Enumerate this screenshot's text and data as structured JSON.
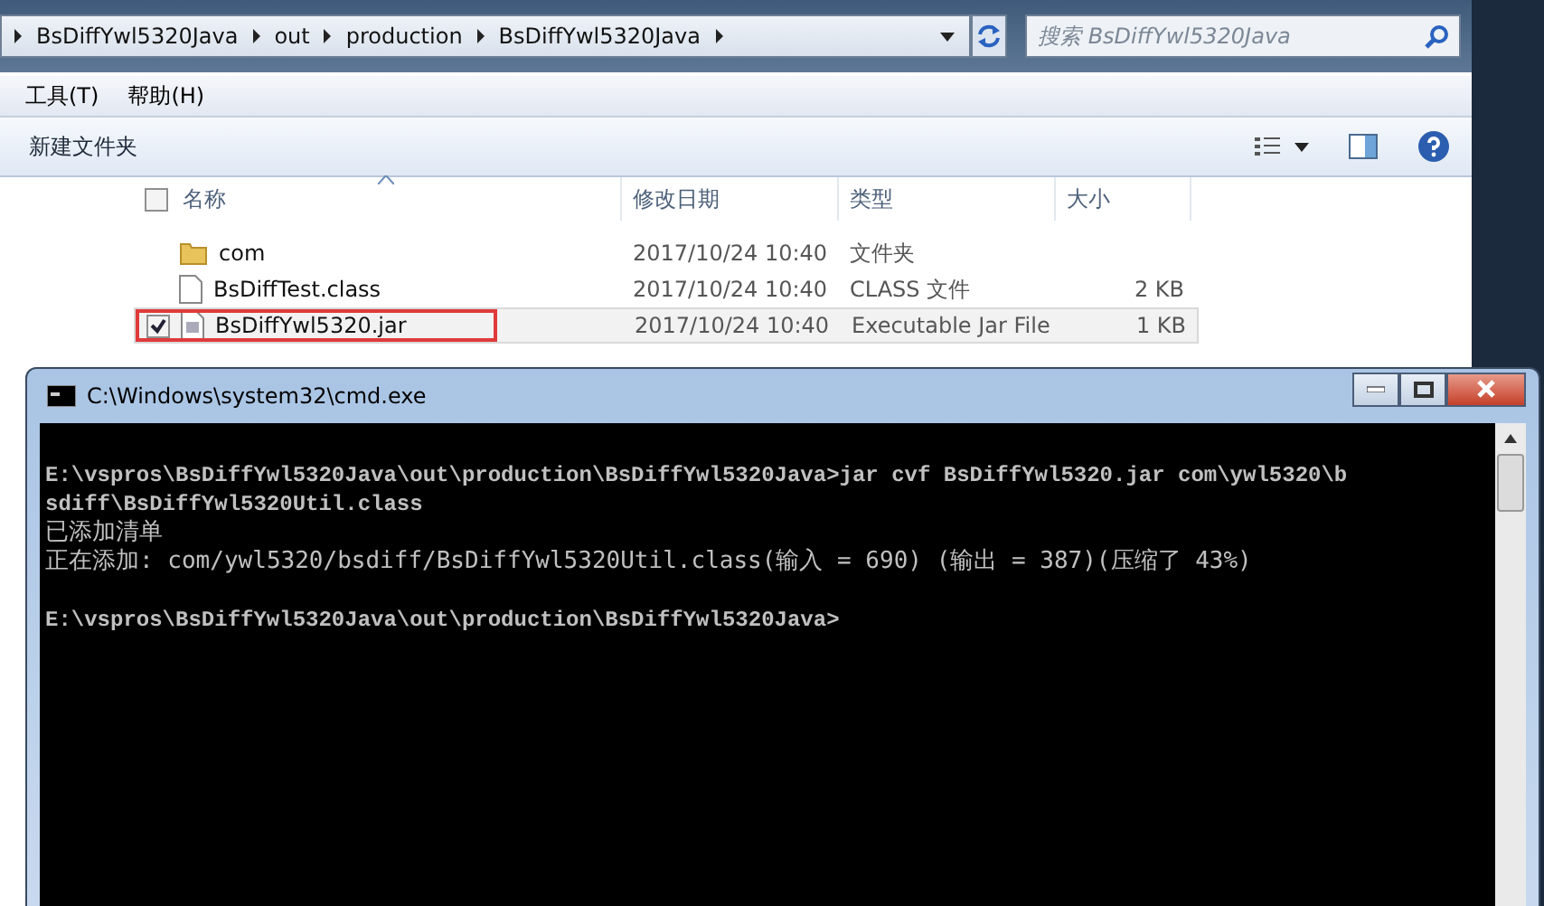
{
  "explorer": {
    "breadcrumb": [
      "BsDiffYwl5320Java",
      "out",
      "production",
      "BsDiffYwl5320Java"
    ],
    "search": {
      "placeholder": "搜索 BsDiffYwl5320Java"
    },
    "menu": [
      "工具(T)",
      "帮助(H)"
    ],
    "toolbar": {
      "new_folder": "新建文件夹"
    },
    "columns": [
      "名称",
      "修改日期",
      "类型",
      "大小"
    ],
    "header_checked": false,
    "rows": [
      {
        "kind": "folder",
        "name": "com",
        "date": "2017/10/24 10:40",
        "type": "文件夹",
        "selected": false
      },
      {
        "kind": "file",
        "name": "BsDiffTest.class",
        "date": "2017/10/24 10:40",
        "type": "CLASS 文件",
        "size": "2 KB",
        "selected": false
      },
      {
        "kind": "jar",
        "name": "BsDiffYwl5320.jar",
        "date": "2017/10/24 10:40",
        "type": "Executable Jar File",
        "size": "1 KB",
        "selected": true
      }
    ]
  },
  "cmd": {
    "title": "C:\\Windows\\system32\\cmd.exe",
    "lines": [
      {
        "kind": "mono",
        "text": "E:\\vspros\\BsDiffYwl5320Java\\out\\production\\BsDiffYwl5320Java>jar cvf BsDiffYwl5320.jar com\\ywl5320\\b"
      },
      {
        "kind": "mono",
        "text": "sdiff\\BsDiffYwl5320Util.class"
      },
      {
        "kind": "wide",
        "text": "已添加清单"
      },
      {
        "kind": "wide",
        "text": "正在添加: com/ywl5320/bsdiff/BsDiffYwl5320Util.class(输入 = 690) (输出 = 387)(压缩了 43%)"
      },
      {
        "kind": "blank"
      },
      {
        "kind": "mono",
        "text": "E:\\vspros\\BsDiffYwl5320Java\\out\\production\\BsDiffYwl5320Java>"
      }
    ]
  }
}
